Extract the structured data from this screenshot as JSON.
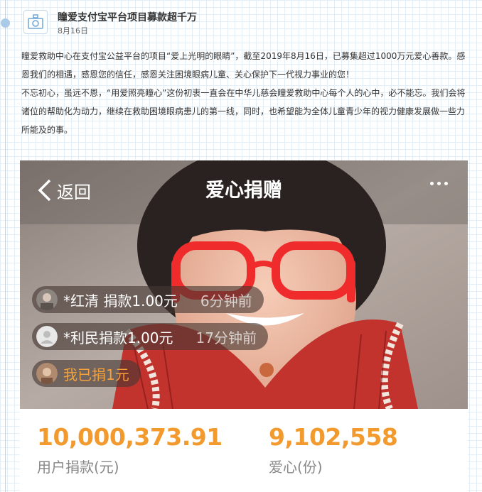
{
  "post": {
    "title": "瞳爱支付宝平台项目募款超千万",
    "date": "8月16日",
    "paragraph1": "瞳爱救助中心在支付宝公益平台的项目“爱上光明的眼睛”，截至2019年8月16日，已募集超过1000万元爱心善款。感恩我们的相遇，感恩您的信任，感恩关注困境眼病儿童、关心保护下一代视力事业的您！",
    "paragraph2": "不忘初心，虽远不恩，“用爱照亮瞳心”这份初衷一直会在中华儿慈会瞳爱救助中心每个人的心中，必不能忘。我们会将诸位的帮助化为动力，继续在救助困境眼病患儿的第一线，同时，也希望能为全体儿童青少年的视力健康发展做一些力所能及的事。",
    "icon": "camera-icon"
  },
  "screenshot": {
    "back_label": "返回",
    "page_title": "爱心捐赠",
    "more_icon": "more-icon",
    "donations": [
      {
        "name": "*红清 捐款1.00元",
        "time": "6分钟前",
        "avatar": "photo-avatar"
      },
      {
        "name": "*利民捐款1.00元",
        "time": "17分钟前",
        "avatar": "default-user-avatar"
      },
      {
        "name": "我已捐1元",
        "time": "",
        "avatar": "photo-avatar"
      }
    ],
    "stats": {
      "amount_value": "10,000,373.91",
      "amount_label": "用户捐款(元)",
      "hearts_value": "9,102,558",
      "hearts_label": "爱心(份)"
    }
  },
  "colors": {
    "accent_orange": "#f29a2e",
    "timeline_blue": "#aacbe8",
    "glasses_red": "#ef2b2b"
  }
}
